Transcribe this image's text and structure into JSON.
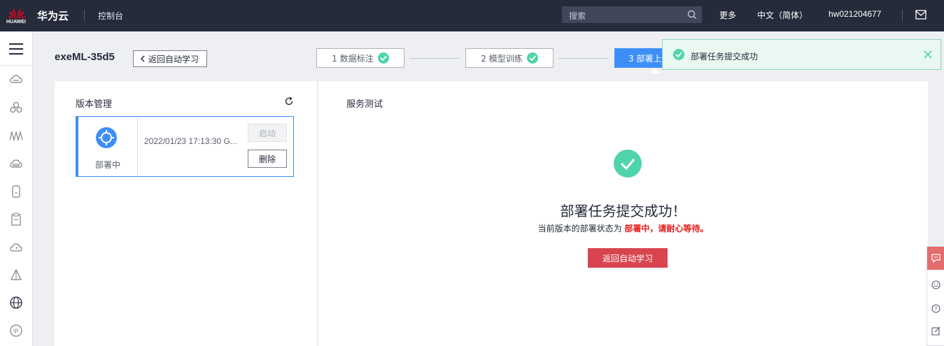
{
  "topbar": {
    "logo_text": "HUAWEI",
    "brand": "华为云",
    "console": "控制台",
    "search_placeholder": "搜索",
    "more": "更多",
    "language": "中文（简体）",
    "username": "hw021204677"
  },
  "page": {
    "title": "exeML-35d5",
    "back_label": "返回自动学习"
  },
  "steps": [
    {
      "label": "1 数据标注",
      "status": "done"
    },
    {
      "label": "2 模型训练",
      "status": "done"
    },
    {
      "label": "3 部署上",
      "status": "active"
    }
  ],
  "toast": {
    "message": "部署任务提交成功"
  },
  "version_panel": {
    "title": "版本管理",
    "card": {
      "status": "部署中",
      "time": "2022/01/23 17:13:30 G...",
      "start_label": "启动",
      "delete_label": "删除"
    }
  },
  "service_panel": {
    "title": "服务测试",
    "success_title": "部署任务提交成功！",
    "status_prefix": "当前版本的部署状态为 ",
    "status_highlight": "部署中，请耐心等待。",
    "return_button": "返回自动学习"
  },
  "colors": {
    "topbar": "#252b3a",
    "primary": "#3e8ef7",
    "success": "#50d4ab",
    "danger_button": "#d9454f",
    "highlight_text": "#e61b1b"
  }
}
